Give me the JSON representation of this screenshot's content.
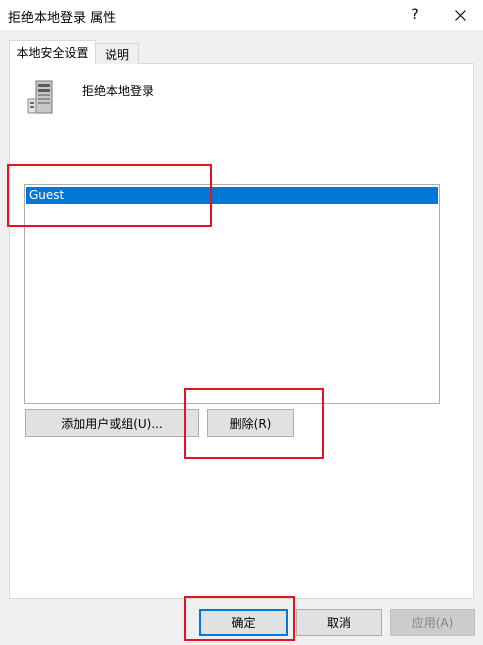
{
  "window": {
    "title": "拒绝本地登录 属性",
    "help_label": "?",
    "close_icon": "close-icon"
  },
  "tabs": [
    {
      "label": "本地安全设置",
      "active": true
    },
    {
      "label": "说明",
      "active": false
    }
  ],
  "policy": {
    "name": "拒绝本地登录",
    "icon": "server-icon"
  },
  "user_list": {
    "items": [
      {
        "label": "Guest",
        "selected": true
      }
    ]
  },
  "panel_buttons": {
    "add_label": "添加用户或组(U)...",
    "remove_label": "删除(R)"
  },
  "dialog_buttons": {
    "ok_label": "确定",
    "cancel_label": "取消",
    "apply_label": "应用(A)",
    "apply_enabled": false
  },
  "colors": {
    "selection": "#0078d7",
    "annotation": "#e81123",
    "default_button_border": "#0078d7"
  }
}
